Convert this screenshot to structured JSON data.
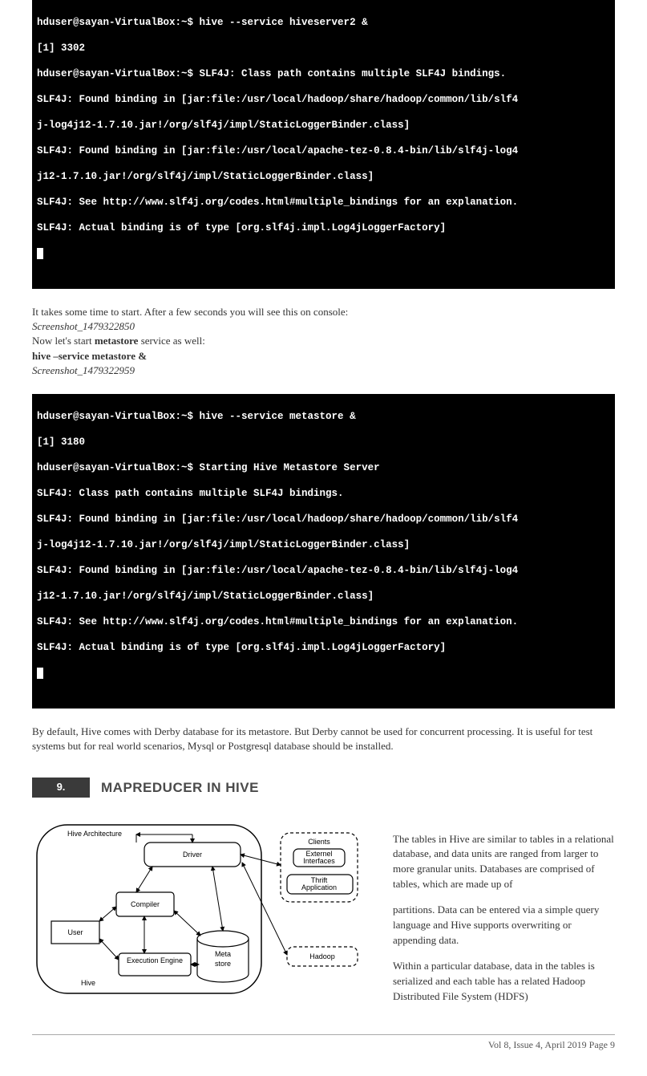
{
  "terminal1": {
    "l1": "hduser@sayan-VirtualBox:~$ hive --service hiveserver2 &",
    "l2": "[1] 3302",
    "l3": "hduser@sayan-VirtualBox:~$ SLF4J: Class path contains multiple SLF4J bindings.",
    "l4": "SLF4J: Found binding in [jar:file:/usr/local/hadoop/share/hadoop/common/lib/slf4",
    "l5": "j-log4j12-1.7.10.jar!/org/slf4j/impl/StaticLoggerBinder.class]",
    "l6": "SLF4J: Found binding in [jar:file:/usr/local/apache-tez-0.8.4-bin/lib/slf4j-log4",
    "l7": "j12-1.7.10.jar!/org/slf4j/impl/StaticLoggerBinder.class]",
    "l8": "SLF4J: See http://www.slf4j.org/codes.html#multiple_bindings for an explanation.",
    "l9": "SLF4J: Actual binding is of type [org.slf4j.impl.Log4jLoggerFactory]"
  },
  "body1": {
    "p1": "It takes some time to start. After a few seconds you will see this on console:",
    "label1": "Screenshot_1479322850",
    "p2_part1": "Now let's start ",
    "p2_bold": "metastore",
    "p2_part2": " service as well:",
    "cmd": "hive –service metastore &",
    "label2": "Screenshot_1479322959"
  },
  "terminal2": {
    "l1": "hduser@sayan-VirtualBox:~$ hive --service metastore &",
    "l2": "[1] 3180",
    "l3": "hduser@sayan-VirtualBox:~$ Starting Hive Metastore Server",
    "l4": "SLF4J: Class path contains multiple SLF4J bindings.",
    "l5": "SLF4J: Found binding in [jar:file:/usr/local/hadoop/share/hadoop/common/lib/slf4",
    "l6": "j-log4j12-1.7.10.jar!/org/slf4j/impl/StaticLoggerBinder.class]",
    "l7": "SLF4J: Found binding in [jar:file:/usr/local/apache-tez-0.8.4-bin/lib/slf4j-log4",
    "l8": "j12-1.7.10.jar!/org/slf4j/impl/StaticLoggerBinder.class]",
    "l9": "SLF4J: See http://www.slf4j.org/codes.html#multiple_bindings for an explanation.",
    "l10": "SLF4J: Actual binding is of type [org.slf4j.impl.Log4jLoggerFactory]"
  },
  "body2": {
    "p1": "By default, Hive comes with Derby database for its metastore. But Derby cannot be used for concurrent processing. It is useful for test systems but for real world scenarios, Mysql or Postgresql database should be installed."
  },
  "heading": {
    "num": "9.",
    "title": "MAPREDUCER IN HIVE"
  },
  "diagram": {
    "left_title": "Hive Architecture",
    "driver": "Driver",
    "compiler": "Compiler",
    "execution": "Execution Engine",
    "meta_title1": "Meta",
    "meta_title2": "store",
    "user": "User",
    "hive": "Hive",
    "clients_title": "Clients",
    "ext1_l1": "Externel",
    "ext1_l2": "Interfaces",
    "ext2_l1": "Thrift",
    "ext2_l2": "Application",
    "hadoop": "Hadoop"
  },
  "right_text": {
    "p1": "The tables in Hive are similar to tables in a relational database, and data units are ranged from larger to more granular units. Databases are comprised of tables, which are made up of",
    "p2": "partitions. Data can be entered via a simple query language and Hive supports overwriting or appending data.",
    "p3": "Within a particular database, data in the tables is serialized and each table has a related Hadoop Distributed File System (HDFS)"
  },
  "footer": "Vol 8, Issue 4, April 2019                                                                                   Page 9"
}
